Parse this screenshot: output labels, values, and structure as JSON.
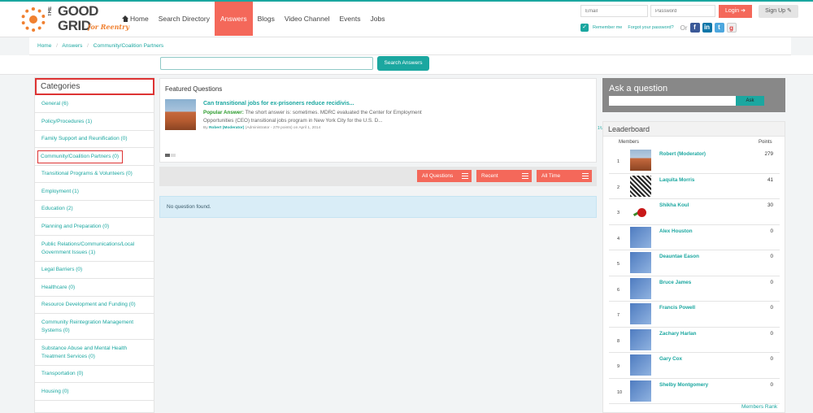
{
  "logo": {
    "the": "THE",
    "good": "GOOD",
    "grid": "GRID",
    "tagline": "for Reentry"
  },
  "nav": {
    "home": "Home",
    "search_directory": "Search Directory",
    "answers": "Answers",
    "blogs": "Blogs",
    "video_channel": "Video Channel",
    "events": "Events",
    "jobs": "Jobs"
  },
  "login": {
    "email_placeholder": "Email",
    "password_placeholder": "Password",
    "login_label": "Login",
    "signup_label": "Sign Up",
    "remember_me": "Remember me",
    "forgot_password": "Forgot your password?",
    "or": "Or"
  },
  "breadcrumb": {
    "home": "Home",
    "answers": "Answers",
    "current": "Community/Coalition Partners",
    "separator": "/"
  },
  "search": {
    "placeholder": "",
    "button_label": "Search Answers"
  },
  "categories": {
    "title": "Categories",
    "items": [
      {
        "label": "General (6)"
      },
      {
        "label": "Policy/Procedures (1)"
      },
      {
        "label": "Family Support and Reunification (0)"
      },
      {
        "label": "Community/Coalition Partners (0)"
      },
      {
        "label": "Transitional Programs & Volunteers (0)"
      },
      {
        "label": "Employment (1)"
      },
      {
        "label": "Education (2)"
      },
      {
        "label": "Planning and Preparation (0)"
      },
      {
        "label": "Public Relations/Communications/Local Government Issues (1)"
      },
      {
        "label": "Legal Barriers (0)"
      },
      {
        "label": "Healthcare (0)"
      },
      {
        "label": "Resource Development and Funding (0)"
      },
      {
        "label": "Community Reintegration Management Systems (0)"
      },
      {
        "label": "Substance Abuse and Mental Health Treatment Services (0)"
      },
      {
        "label": "Transportation (0)"
      },
      {
        "label": "Housing (0)"
      }
    ]
  },
  "featured": {
    "title": "Featured Questions",
    "question": "Can transitional jobs for ex-prisoners reduce recidivis...",
    "popular_label": "Popular Answer:",
    "answer": "The short answer is: sometimes. MDRC evaluated the Center for Employment Opportunities (CEO) transitional jobs program in New York City for the U.S. D...",
    "meta_by": "By",
    "meta_author": "Robert (Moderator)",
    "meta_rest": "(Administrator - 279 points)  on April 1, 2014",
    "answer_count": "1"
  },
  "filters": {
    "all_questions": "All Questions",
    "recent": "Recent",
    "all_time": "All Time"
  },
  "no_question": "No question found.",
  "ask": {
    "title": "Ask a question",
    "button_label": "Ask"
  },
  "leaderboard": {
    "title": "Leaderboard",
    "col_members": "Members",
    "col_points": "Points",
    "rows": [
      {
        "rank": "1",
        "name": "Robert (Moderator)",
        "points": "279"
      },
      {
        "rank": "2",
        "name": "Laquita Morris",
        "points": "41"
      },
      {
        "rank": "3",
        "name": "Shikha Koul",
        "points": "30"
      },
      {
        "rank": "4",
        "name": "Alex Houston",
        "points": "0"
      },
      {
        "rank": "5",
        "name": "Deauntae Eason",
        "points": "0"
      },
      {
        "rank": "6",
        "name": "Bruce James",
        "points": "0"
      },
      {
        "rank": "7",
        "name": "Francis Powell",
        "points": "0"
      },
      {
        "rank": "8",
        "name": "Zachary Harlan",
        "points": "0"
      },
      {
        "rank": "9",
        "name": "Gary Cox",
        "points": "0"
      },
      {
        "rank": "10",
        "name": "Shelby Montgomery",
        "points": "0"
      }
    ],
    "members_rank": "Members Rank"
  },
  "colors": {
    "accent": "#1ba7a0",
    "active_nav": "#f4685a",
    "highlight_border": "#dd3333"
  }
}
